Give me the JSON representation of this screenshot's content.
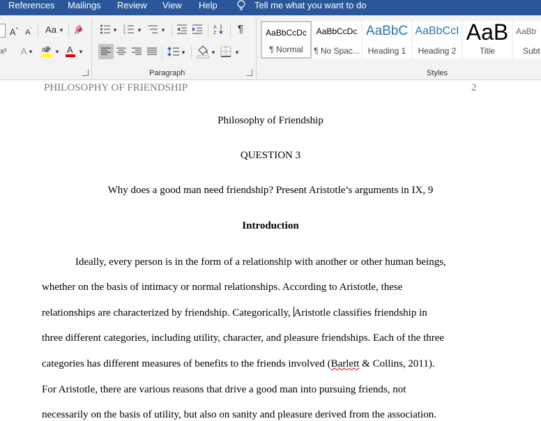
{
  "menu": {
    "items": [
      "References",
      "Mailings",
      "Review",
      "View",
      "Help"
    ],
    "tell_me": "Tell me what you want to do"
  },
  "ribbon": {
    "font_group": {
      "change_case": "Aa",
      "superscript_label": "x²"
    },
    "paragraph_label": "Paragraph",
    "styles_label": "Styles",
    "styles": [
      {
        "preview": "AaBbCcDc",
        "name": "¶ Normal"
      },
      {
        "preview": "AaBbCcDc",
        "name": "¶ No Spac..."
      },
      {
        "preview": "AaBbC",
        "name": "Heading 1"
      },
      {
        "preview": "AaBbCcI",
        "name": "Heading 2"
      },
      {
        "preview": "AaB",
        "name": "Title"
      },
      {
        "preview": "AaBb",
        "name": "Subt"
      }
    ]
  },
  "colors": {
    "menubar": "#2b579a",
    "heading_blue": "#2e74b5",
    "highlight": "#ffff00",
    "font_color": "#e00000"
  },
  "document": {
    "header_left": "PHILOSOPHY OF FRIENDSHIP",
    "header_page": "2",
    "title": "Philosophy of Friendship",
    "question": "QUESTION 3",
    "prompt": "Why does a good man need friendship? Present Aristotle’s arguments in IX, 9",
    "section_heading": "Introduction",
    "lines": {
      "l1": "Ideally, every person is in the form of a relationship with another or other human beings,",
      "l2": "whether on the basis of intimacy or normal relationships. According to Aristotle, these",
      "l3a": "relationships are characterized by friendship. Categorically, ",
      "l3b": "Aristotle classifies friendship in",
      "l4": "three different categories, including utility, character, and pleasure friendships. Each of the three",
      "l5a": "categories has different measures of benefits to the friends involved (",
      "l5b": "Barlett",
      "l5c": " & Collins, 2011).",
      "l6": "For Aristotle, there are various reasons that drive a good man into pursuing friends, not",
      "l7": "necessarily on the basis of utility, but also on sanity and pleasure derived from the association."
    }
  }
}
